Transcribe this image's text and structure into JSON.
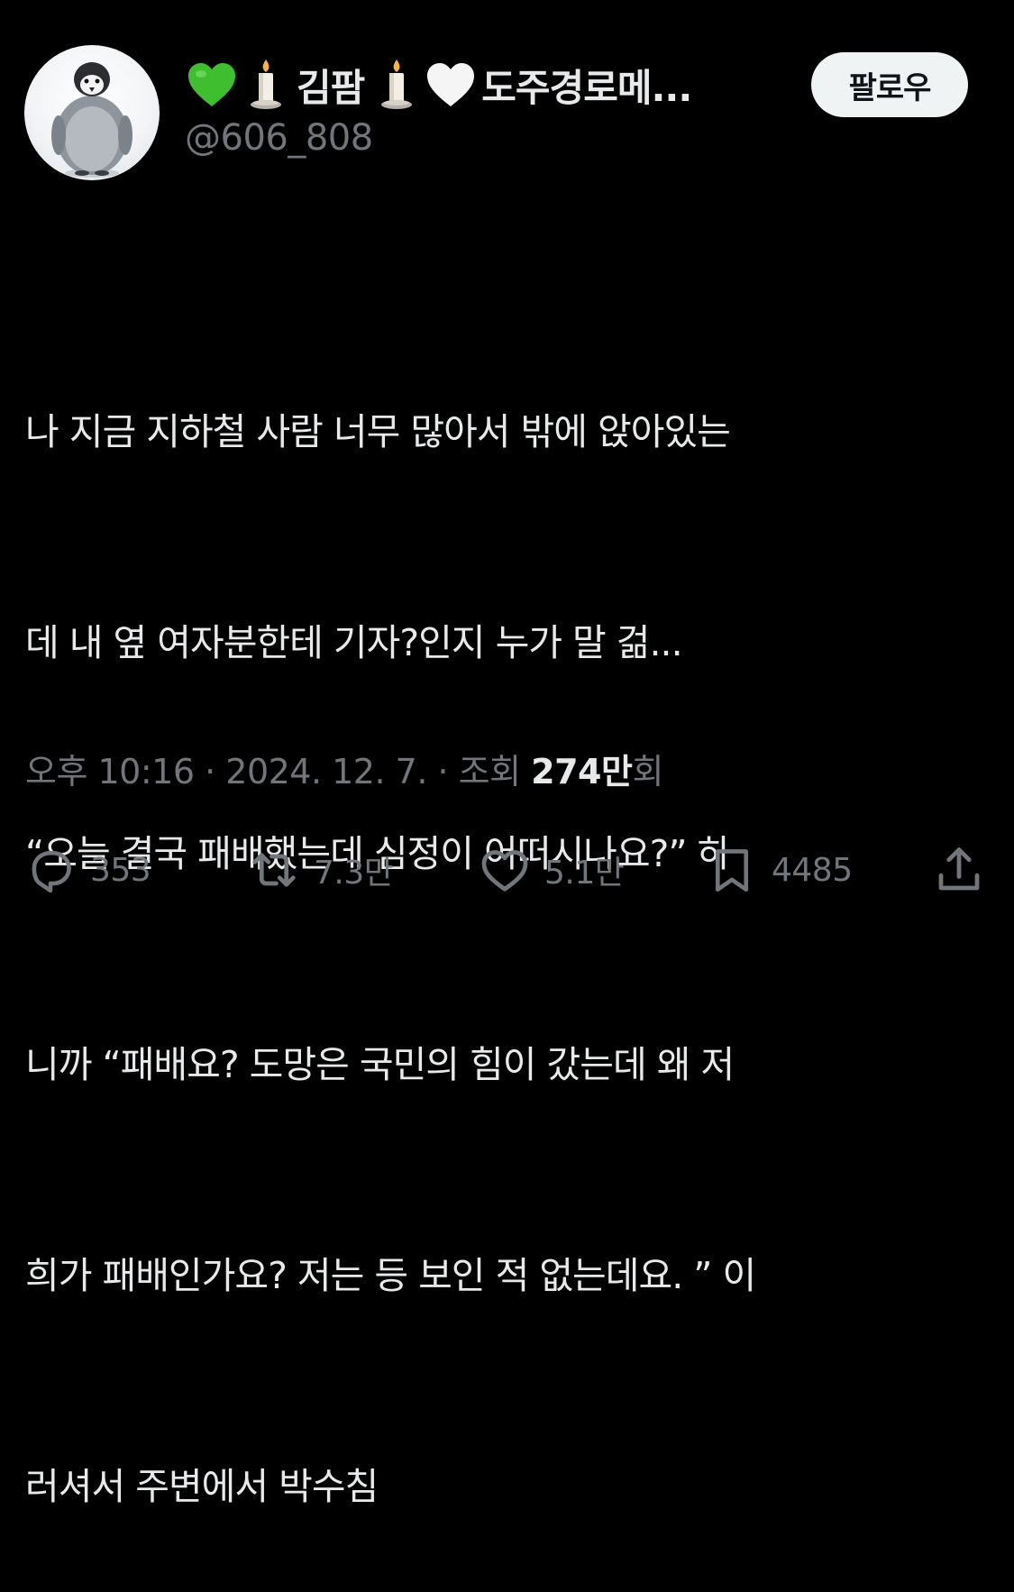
{
  "author": {
    "name_emoji_1": "green-heart",
    "name_emoji_2": "candle",
    "name_text_1": "김팜",
    "name_emoji_3": "candle",
    "name_emoji_4": "white-heart",
    "name_text_2": "도주경로메...",
    "handle": "@606_808",
    "avatar": "penguin-chick"
  },
  "follow_label": "팔로우",
  "tweet": {
    "lines": [
      "나 지금 지하철 사람 너무 많아서 밖에 앉아있는",
      "데 내 옆 여자분한테 기자?인지 누가 말 걺...",
      "“오늘 결국 패배했는데 심정이 어떠시나요?” 하",
      "니까 “패배요? 도망은 국민의 힘이 갔는데 왜 저",
      "희가 패배인가요? 저는 등 보인 적 없는데요. ” 이",
      "러셔서 주변에서 박수침"
    ]
  },
  "meta": {
    "time": "오후 10:16",
    "separator": " · ",
    "date": "2024. 12. 7.",
    "views_label": "조회",
    "views_count": "274만",
    "views_suffix": "회"
  },
  "actions": {
    "reply": {
      "icon": "reply-icon",
      "count": "353"
    },
    "retweet": {
      "icon": "retweet-icon",
      "count": "7.3만"
    },
    "like": {
      "icon": "heart-icon",
      "count": "5.1만"
    },
    "bookmark": {
      "icon": "bookmark-icon",
      "count": "4485"
    },
    "share": {
      "icon": "share-icon"
    }
  },
  "colors": {
    "background": "#000000",
    "primary_text": "#e7e9ea",
    "secondary_text": "#71767b",
    "green_heart": "#3fbf2f",
    "follow_bg": "#eff3f4"
  }
}
